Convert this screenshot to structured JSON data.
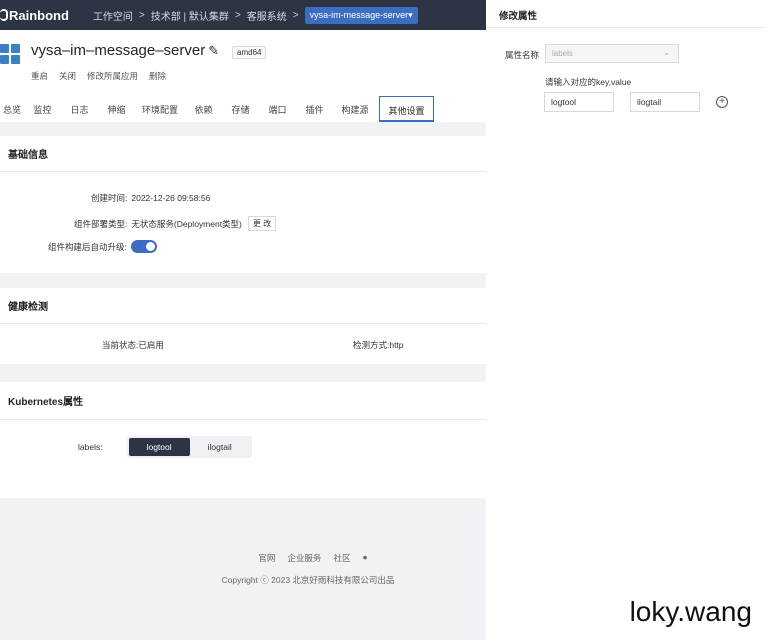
{
  "topbar": {
    "brand": "Rainbond",
    "breadcrumbs": [
      "工作空间",
      "技术部 | 默认集群",
      "客服系统"
    ],
    "current_app": "vysa-im-message-server▾"
  },
  "header": {
    "title": "vysa–im–message–server",
    "arch_badge": "amd64",
    "actions": [
      "重启",
      "关闭",
      "修改所属应用",
      "删除"
    ],
    "tabs": [
      "总览",
      "监控",
      "日志",
      "伸缩",
      "环境配置",
      "依赖",
      "存储",
      "端口",
      "插件",
      "构建源",
      "其他设置"
    ],
    "active_tab": "其他设置"
  },
  "basic": {
    "title": "基础信息",
    "created_label": "创建时间:",
    "created_value": "2022-12-26 09:58:56",
    "deploy_label": "组件部署类型:",
    "deploy_value": "无状态服务(Deployment类型)",
    "change_btn": "更 改",
    "auto_upgrade_label": "组件构建后自动升级:"
  },
  "health": {
    "title": "健康检测",
    "status": "当前状态:已启用",
    "method": "检测方式:http"
  },
  "k8s": {
    "title": "Kubernetes属性",
    "labels_label": "labels:",
    "labels": [
      "logtool",
      "ilogtail"
    ]
  },
  "footer": {
    "links": [
      "官网",
      "企业服务",
      "社区"
    ],
    "copyright": "Copyright ⓒ 2023 北京好雨科技有限公司出品"
  },
  "drawer": {
    "title": "修改属性",
    "field_label": "属性名称",
    "select_value": "labels",
    "hint": "请输入对应的key,value",
    "key": "logtool",
    "value": "ilogtail"
  },
  "watermark": "loky.wang"
}
